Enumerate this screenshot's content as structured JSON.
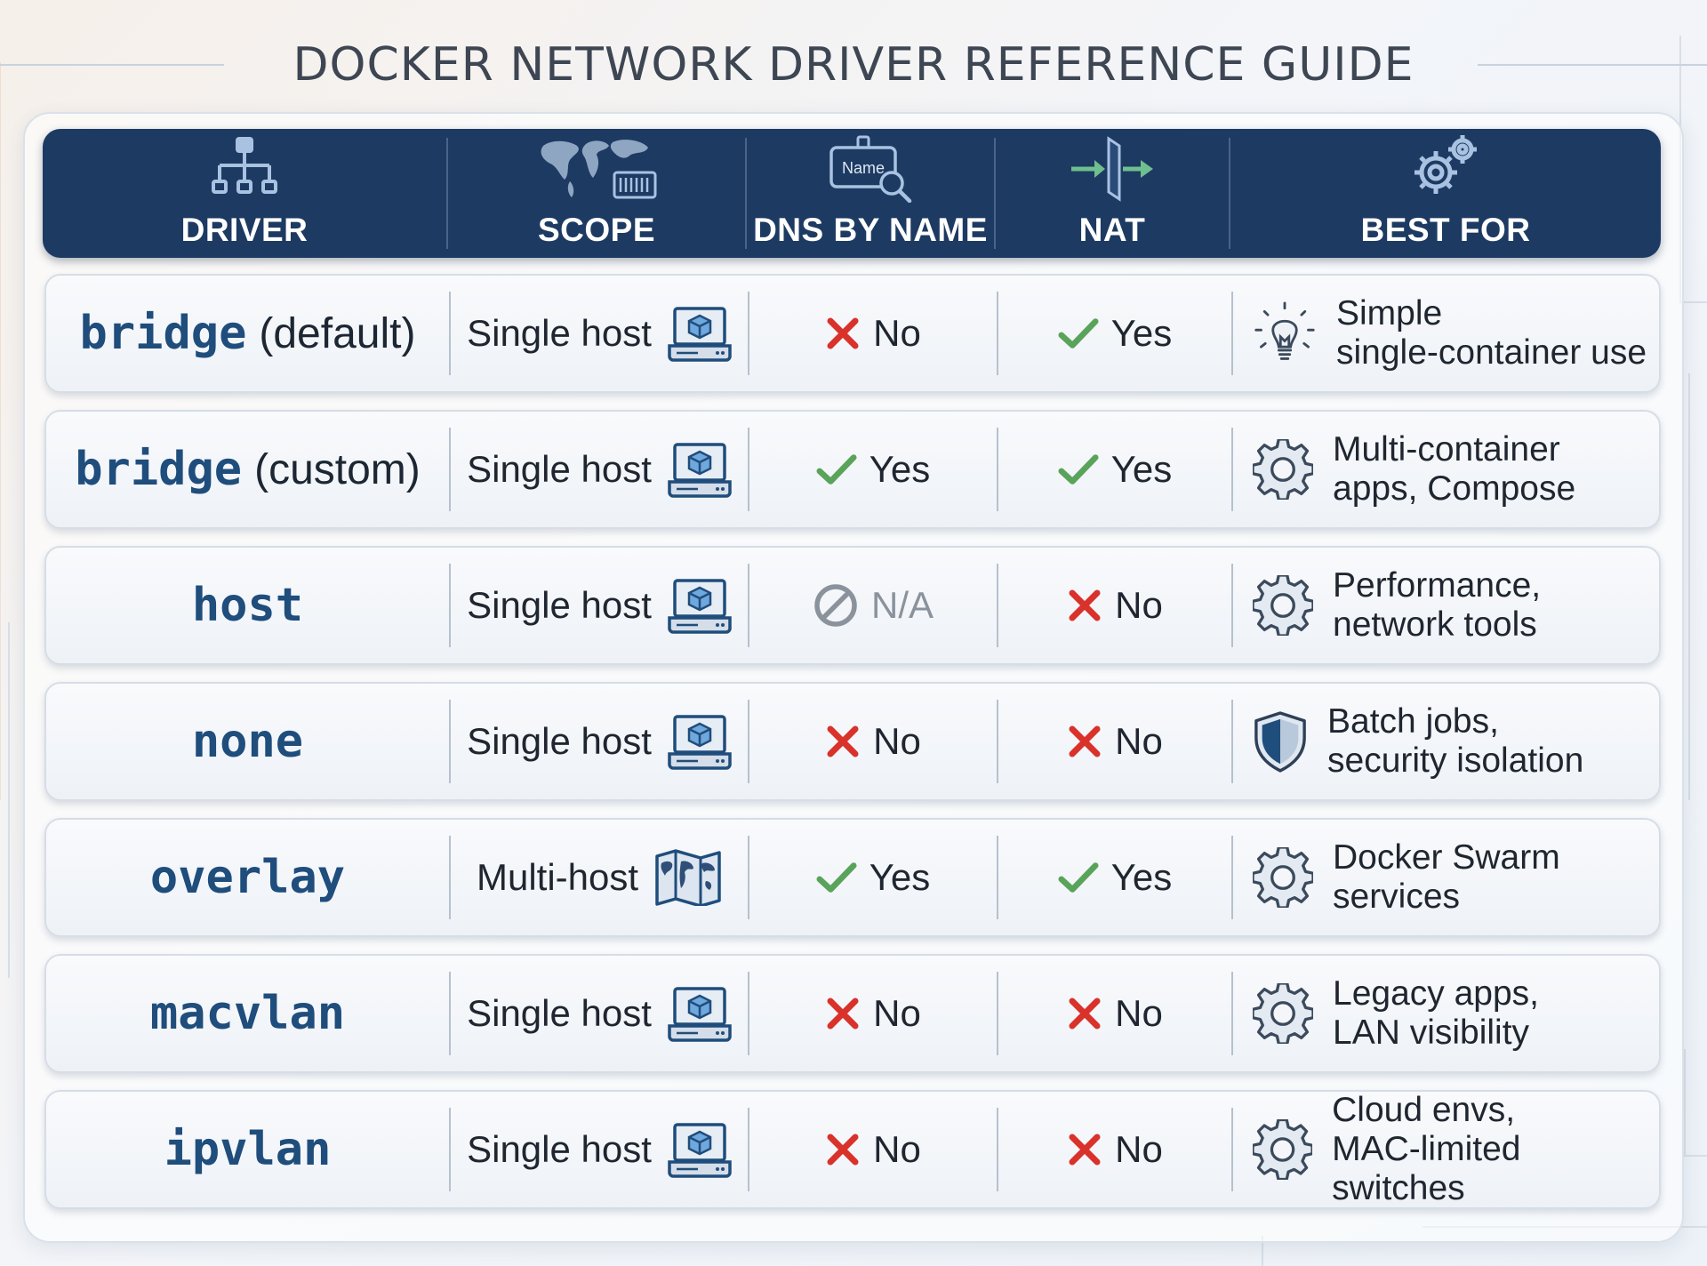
{
  "title": "DOCKER NETWORK DRIVER REFERENCE GUIDE",
  "header": {
    "driver": "DRIVER",
    "scope": "SCOPE",
    "dns": "DNS BY NAME",
    "nat": "NAT",
    "best_for": "BEST FOR",
    "dns_icon_text": "Name"
  },
  "rows": [
    {
      "driver": "bridge",
      "suffix": "(default)",
      "scope": "Single host",
      "scope_icon": "laptop-icon",
      "dns": "No",
      "dns_icon": "cross-icon",
      "nat": "Yes",
      "nat_icon": "check-icon",
      "best_line1": "Simple",
      "best_line2": "single-container use",
      "best_icon": "lightbulb-icon"
    },
    {
      "driver": "bridge",
      "suffix": "(custom)",
      "scope": "Single host",
      "scope_icon": "laptop-icon",
      "dns": "Yes",
      "dns_icon": "check-icon",
      "nat": "Yes",
      "nat_icon": "check-icon",
      "best_line1": "Multi-container",
      "best_line2": "apps, Compose",
      "best_icon": "gear-icon"
    },
    {
      "driver": "host",
      "suffix": "",
      "scope": "Single host",
      "scope_icon": "laptop-icon",
      "dns": "N/A",
      "dns_icon": "not-applicable-icon",
      "nat": "No",
      "nat_icon": "cross-icon",
      "best_line1": "Performance,",
      "best_line2": "network tools",
      "best_icon": "gear-icon"
    },
    {
      "driver": "none",
      "suffix": "",
      "scope": "Single host",
      "scope_icon": "laptop-icon",
      "dns": "No",
      "dns_icon": "cross-icon",
      "nat": "No",
      "nat_icon": "cross-icon",
      "best_line1": "Batch jobs,",
      "best_line2": "security isolation",
      "best_icon": "shield-icon"
    },
    {
      "driver": "overlay",
      "suffix": "",
      "scope": "Multi-host",
      "scope_icon": "world-map-icon",
      "dns": "Yes",
      "dns_icon": "check-icon",
      "nat": "Yes",
      "nat_icon": "check-icon",
      "best_line1": "Docker Swarm",
      "best_line2": "services",
      "best_icon": "gear-icon"
    },
    {
      "driver": "macvlan",
      "suffix": "",
      "scope": "Single host",
      "scope_icon": "laptop-icon",
      "dns": "No",
      "dns_icon": "cross-icon",
      "nat": "No",
      "nat_icon": "cross-icon",
      "best_line1": "Legacy apps,",
      "best_line2": "LAN visibility",
      "best_icon": "gear-icon"
    },
    {
      "driver": "ipvlan",
      "suffix": "",
      "scope": "Single host",
      "scope_icon": "laptop-icon",
      "dns": "No",
      "dns_icon": "cross-icon",
      "nat": "No",
      "nat_icon": "cross-icon",
      "best_line1": "Cloud envs,",
      "best_line2": "MAC-limited switches",
      "best_icon": "gear-icon"
    }
  ],
  "colors": {
    "header_bg": "#1d3a62",
    "driver_text": "#1f4d7c",
    "check": "#5aa35a",
    "cross": "#d9322b",
    "icon_blue": "#1f4d7c"
  }
}
